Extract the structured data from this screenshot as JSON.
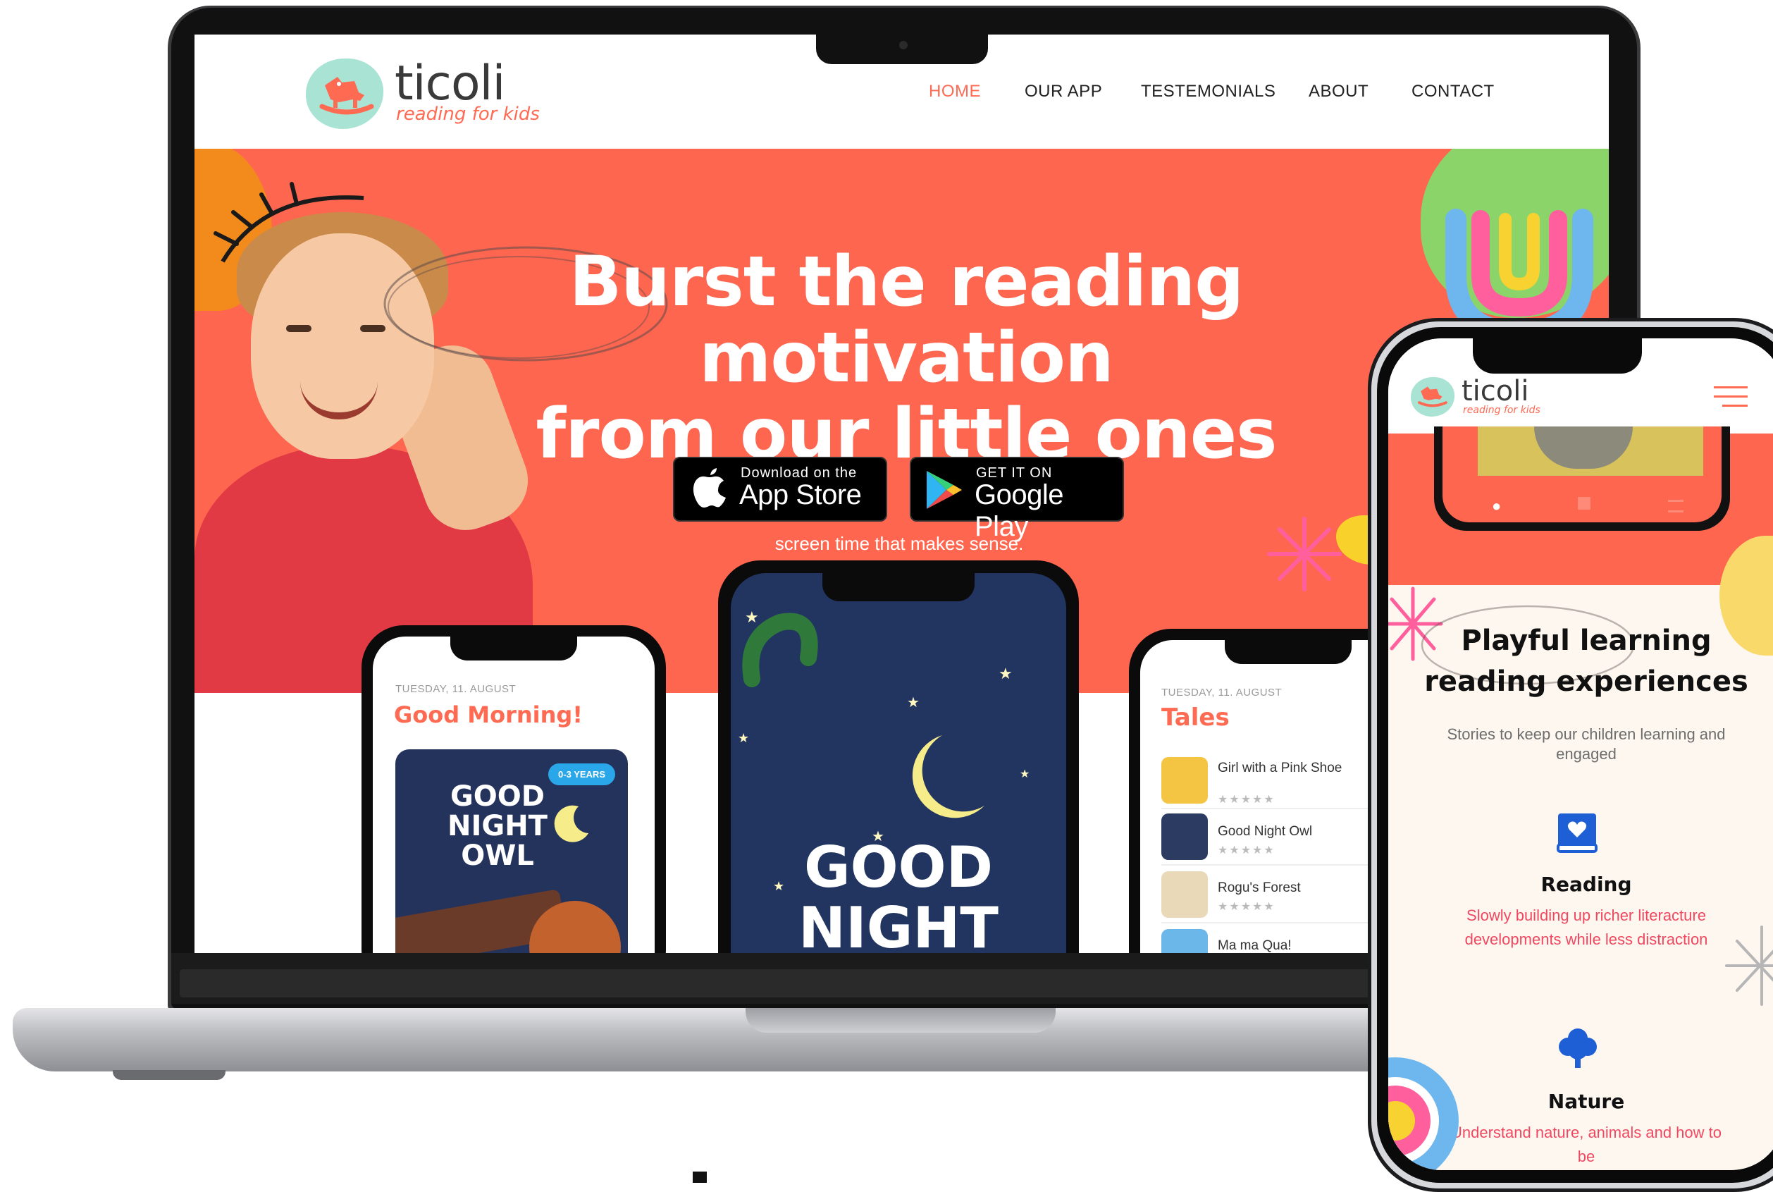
{
  "brand": {
    "name": "ticoli",
    "tagline": "reading for kids",
    "accent": "#fe6650",
    "mint": "#a9e3d3"
  },
  "nav": {
    "items": [
      {
        "label": "HOME",
        "active": true
      },
      {
        "label": "OUR APP",
        "active": false
      },
      {
        "label": "TESTEMONIALS",
        "active": false
      },
      {
        "label": "ABOUT",
        "active": false
      },
      {
        "label": "CONTACT",
        "active": false
      }
    ]
  },
  "hero": {
    "title_line1": "Burst the reading motivation",
    "title_line2": "from our little ones",
    "app_store": {
      "small": "Download on the",
      "big": "App Store"
    },
    "google_play": {
      "small": "GET IT ON",
      "big": "Google Play"
    },
    "subtitle": "screen time that makes sense."
  },
  "phone_left": {
    "date": "TUESDAY, 11. AUGUST",
    "greeting": "Good Morning!",
    "book": {
      "title_lines": [
        "GOOD",
        "NIGHT",
        "OWL"
      ],
      "age_badge": "0-3 YEARS"
    }
  },
  "phone_center": {
    "title_lines": [
      "GOOD",
      "NIGHT"
    ]
  },
  "phone_right": {
    "date": "TUESDAY, 11. AUGUST",
    "heading": "Tales",
    "tales": [
      {
        "name": "Girl with a Pink Shoe",
        "stars": "★★★★★"
      },
      {
        "name": "Good Night Owl",
        "stars": "★★★★★"
      },
      {
        "name": "Rogu's Forest",
        "stars": "★★★★★"
      },
      {
        "name": "Ma ma Qua!",
        "stars": ""
      }
    ]
  },
  "mobile": {
    "brand": "ticoli",
    "tagline": "reading for kids",
    "menu_icon": "hamburger-icon",
    "section_title_line1": "Playful learning",
    "section_title_line2": "reading experiences",
    "section_subtitle": "Stories to keep our children learning and engaged",
    "features": [
      {
        "icon": "book-heart-icon",
        "title": "Reading",
        "text": "Slowly building up richer literacture developments while less distraction"
      },
      {
        "icon": "tree-icon",
        "title": "Nature",
        "text": "Understand nature, animals and how to be"
      }
    ]
  }
}
